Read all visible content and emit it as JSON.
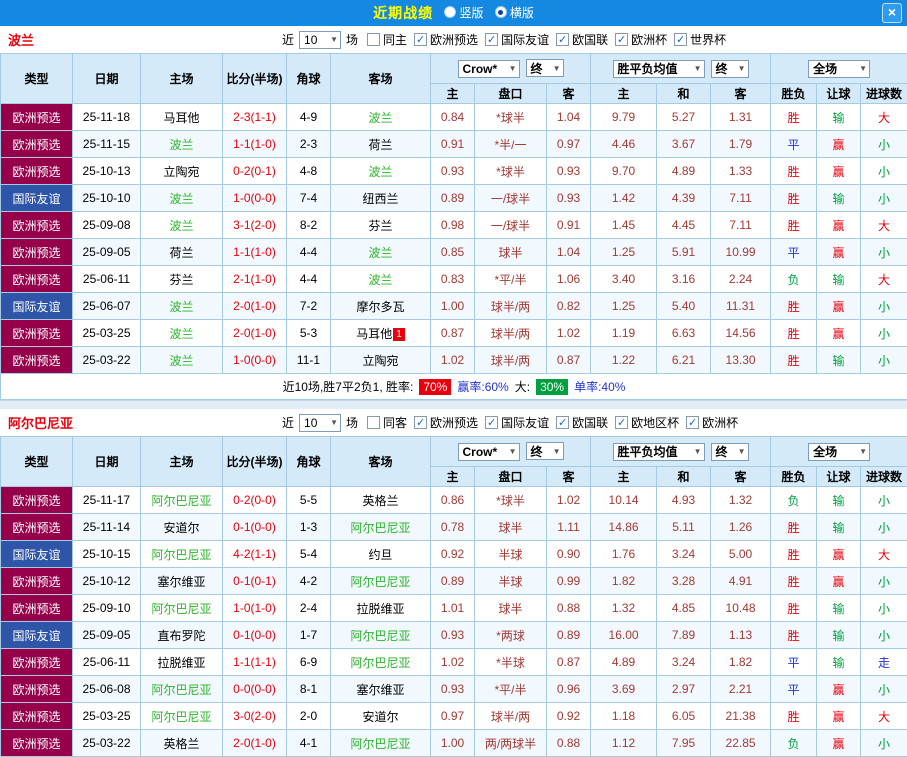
{
  "titlebar": {
    "title": "近期战绩",
    "vertical_label": "竖版",
    "horizontal_label": "横版",
    "close_label": "×"
  },
  "filters_common": {
    "near_label": "近",
    "count": "10",
    "games_label": "场"
  },
  "header": {
    "static_cols": [
      "类型",
      "日期",
      "主场",
      "比分(半场)",
      "角球",
      "客场"
    ],
    "odds_source_dropdown": "Crow*",
    "odds_final_dropdown": "终",
    "avg_dropdown": "胜平负均值",
    "avg_final_dropdown": "终",
    "scope_dropdown": "全场",
    "sub_cols": [
      "主",
      "盘口",
      "客",
      "主",
      "和",
      "客",
      "胜负",
      "让球",
      "进球数"
    ]
  },
  "sections": [
    {
      "team": "波兰",
      "venue_filter": {
        "label": "同主",
        "checked": false
      },
      "competition_filters": [
        {
          "label": "欧洲预选",
          "checked": true
        },
        {
          "label": "国际友谊",
          "checked": true
        },
        {
          "label": "欧国联",
          "checked": true
        },
        {
          "label": "欧洲杯",
          "checked": true
        },
        {
          "label": "世界杯",
          "checked": true
        }
      ],
      "rows": [
        [
          "欧洲预选",
          "25-11-18",
          "马耳他",
          "2-3(1-1)",
          "4-9",
          "波兰",
          "0.84",
          "*球半",
          "1.04",
          "9.79",
          "5.27",
          "1.31",
          "胜",
          "输",
          "大"
        ],
        [
          "欧洲预选",
          "25-11-15",
          "波兰",
          "1-1(1-0)",
          "2-3",
          "荷兰",
          "0.91",
          "*半/一",
          "0.97",
          "4.46",
          "3.67",
          "1.79",
          "平",
          "赢",
          "小"
        ],
        [
          "欧洲预选",
          "25-10-13",
          "立陶宛",
          "0-2(0-1)",
          "4-8",
          "波兰",
          "0.93",
          "*球半",
          "0.93",
          "9.70",
          "4.89",
          "1.33",
          "胜",
          "赢",
          "小"
        ],
        [
          "国际友谊",
          "25-10-10",
          "波兰",
          "1-0(0-0)",
          "7-4",
          "纽西兰",
          "0.89",
          "一/球半",
          "0.93",
          "1.42",
          "4.39",
          "7.11",
          "胜",
          "输",
          "小"
        ],
        [
          "欧洲预选",
          "25-09-08",
          "波兰",
          "3-1(2-0)",
          "8-2",
          "芬兰",
          "0.98",
          "一/球半",
          "0.91",
          "1.45",
          "4.45",
          "7.11",
          "胜",
          "赢",
          "大"
        ],
        [
          "欧洲预选",
          "25-09-05",
          "荷兰",
          "1-1(1-0)",
          "4-4",
          "波兰",
          "0.85",
          "球半",
          "1.04",
          "1.25",
          "5.91",
          "10.99",
          "平",
          "赢",
          "小"
        ],
        [
          "欧洲预选",
          "25-06-11",
          "芬兰",
          "2-1(1-0)",
          "4-4",
          "波兰",
          "0.83",
          "*平/半",
          "1.06",
          "3.40",
          "3.16",
          "2.24",
          "负",
          "输",
          "大"
        ],
        [
          "国际友谊",
          "25-06-07",
          "波兰",
          "2-0(1-0)",
          "7-2",
          "摩尔多瓦",
          "1.00",
          "球半/两",
          "0.82",
          "1.25",
          "5.40",
          "11.31",
          "胜",
          "赢",
          "小"
        ],
        [
          "欧洲预选",
          "25-03-25",
          "波兰",
          "2-0(1-0)",
          "5-3",
          {
            "text": "马耳他",
            "badge": "1"
          },
          "0.87",
          "球半/两",
          "1.02",
          "1.19",
          "6.63",
          "14.56",
          "胜",
          "赢",
          "小"
        ],
        [
          "欧洲预选",
          "25-03-22",
          "波兰",
          "1-0(0-0)",
          "11-1",
          "立陶宛",
          "1.02",
          "球半/两",
          "0.87",
          "1.22",
          "6.21",
          "13.30",
          "胜",
          "输",
          "小"
        ]
      ],
      "summary": {
        "record_text": "近10场,胜7平2负1, 胜率:",
        "win_rate": "70%",
        "odds_win_text": "赢率:60%",
        "big_label": "大:",
        "big_rate": "30%",
        "single_text": "单率:40%"
      }
    },
    {
      "team": "阿尔巴尼亚",
      "venue_filter": {
        "label": "同客",
        "checked": false
      },
      "competition_filters": [
        {
          "label": "欧洲预选",
          "checked": true
        },
        {
          "label": "国际友谊",
          "checked": true
        },
        {
          "label": "欧国联",
          "checked": true
        },
        {
          "label": "欧地区杯",
          "checked": true
        },
        {
          "label": "欧洲杯",
          "checked": true
        }
      ],
      "rows": [
        [
          "欧洲预选",
          "25-11-17",
          "阿尔巴尼亚",
          "0-2(0-0)",
          "5-5",
          "英格兰",
          "0.86",
          "*球半",
          "1.02",
          "10.14",
          "4.93",
          "1.32",
          "负",
          "输",
          "小"
        ],
        [
          "欧洲预选",
          "25-11-14",
          "安道尔",
          "0-1(0-0)",
          "1-3",
          "阿尔巴尼亚",
          "0.78",
          "球半",
          "1.11",
          "14.86",
          "5.11",
          "1.26",
          "胜",
          "输",
          "小"
        ],
        [
          "国际友谊",
          "25-10-15",
          "阿尔巴尼亚",
          "4-2(1-1)",
          "5-4",
          "约旦",
          "0.92",
          "半球",
          "0.90",
          "1.76",
          "3.24",
          "5.00",
          "胜",
          "赢",
          "大"
        ],
        [
          "欧洲预选",
          "25-10-12",
          "塞尔维亚",
          "0-1(0-1)",
          "4-2",
          "阿尔巴尼亚",
          "0.89",
          "半球",
          "0.99",
          "1.82",
          "3.28",
          "4.91",
          "胜",
          "赢",
          "小"
        ],
        [
          "欧洲预选",
          "25-09-10",
          "阿尔巴尼亚",
          "1-0(1-0)",
          "2-4",
          "拉脱维亚",
          "1.01",
          "球半",
          "0.88",
          "1.32",
          "4.85",
          "10.48",
          "胜",
          "输",
          "小"
        ],
        [
          "国际友谊",
          "25-09-05",
          "直布罗陀",
          "0-1(0-0)",
          "1-7",
          "阿尔巴尼亚",
          "0.93",
          "*两球",
          "0.89",
          "16.00",
          "7.89",
          "1.13",
          "胜",
          "输",
          "小"
        ],
        [
          "欧洲预选",
          "25-06-11",
          "拉脱维亚",
          "1-1(1-1)",
          "6-9",
          "阿尔巴尼亚",
          "1.02",
          "*半球",
          "0.87",
          "4.89",
          "3.24",
          "1.82",
          "平",
          "输",
          "走"
        ],
        [
          "欧洲预选",
          "25-06-08",
          "阿尔巴尼亚",
          "0-0(0-0)",
          "8-1",
          "塞尔维亚",
          "0.93",
          "*平/半",
          "0.96",
          "3.69",
          "2.97",
          "2.21",
          "平",
          "赢",
          "小"
        ],
        [
          "欧洲预选",
          "25-03-25",
          "阿尔巴尼亚",
          "3-0(2-0)",
          "2-0",
          "安道尔",
          "0.97",
          "球半/两",
          "0.92",
          "1.18",
          "6.05",
          "21.38",
          "胜",
          "赢",
          "大"
        ],
        [
          "欧洲预选",
          "25-03-22",
          "英格兰",
          "2-0(1-0)",
          "4-1",
          "阿尔巴尼亚",
          "1.00",
          "两/两球半",
          "0.88",
          "1.12",
          "7.95",
          "22.85",
          "负",
          "赢",
          "小"
        ]
      ]
    }
  ]
}
